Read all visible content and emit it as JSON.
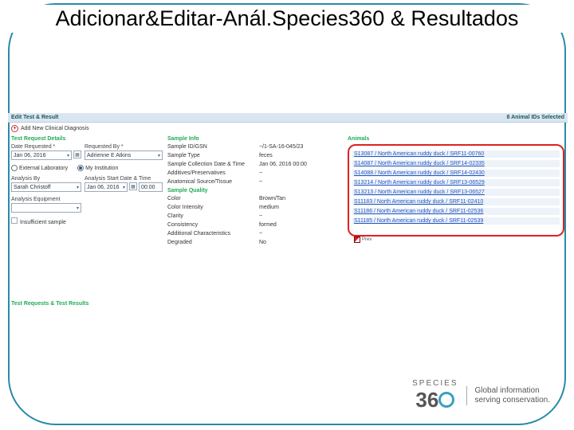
{
  "title": "Adicionar&Editar-Anál.Species360 & Resultados",
  "header": {
    "left": "Edit Test & Result",
    "right": "8 Animal IDs Selected"
  },
  "add_diag": "Add New Clinical Diagnosis",
  "left": {
    "section": "Test Request Details",
    "date_requested_lbl": "Date Requested *",
    "date_requested": "Jan 06, 2016",
    "requested_by_lbl": "Requested By *",
    "requested_by": "Adrienne E Atkins",
    "radio_ext": "External Laboratory",
    "radio_inst": "My Institution",
    "analysis_by_lbl": "Analysis By",
    "analysis_by": "Sarah Christoff",
    "analysis_start_lbl": "Analysis Start Date & Time",
    "analysis_start_date": "Jan 06, 2016",
    "analysis_start_time": "00:00",
    "equip_lbl": "Analysis Equipment",
    "insufficient": "Insufficient sample"
  },
  "mid": {
    "section1": "Sample Info",
    "kv1": [
      {
        "k": "Sample ID/GSN",
        "v": "~/1-SA-16-045/23"
      },
      {
        "k": "Sample Type",
        "v": "feces"
      },
      {
        "k": "Sample Collection Date & Time",
        "v": "Jan 06, 2016 00:00"
      },
      {
        "k": "Additives/Preservatives",
        "v": "~"
      },
      {
        "k": "Anatomical Source/Tissue",
        "v": "~"
      }
    ],
    "section2": "Sample Quality",
    "kv2": [
      {
        "k": "Color",
        "v": "Brown/Tan"
      },
      {
        "k": "Color Intensity",
        "v": "medium"
      },
      {
        "k": "Clarity",
        "v": "~"
      },
      {
        "k": "Consistency",
        "v": "formed"
      },
      {
        "k": "Additional Characteristics",
        "v": "~"
      },
      {
        "k": "Degraded",
        "v": "No"
      }
    ]
  },
  "right": {
    "section": "Animals",
    "items": [
      "S13087 / North American ruddy duck / SRF11-00760",
      "S14087 / North American ruddy duck / SRF14-02335",
      "S14088 / North American ruddy duck / SRF14-02430",
      "S13214 / North American ruddy duck / SRF13-06529",
      "S13213 / North American ruddy duck / SRF13-06527",
      "S11183 / North American ruddy duck / SRF11-02410",
      "S11186 / North American ruddy duck / SRF11-02536",
      "S11185 / North American ruddy duck / SRF11-02539"
    ],
    "prev": "Prev"
  },
  "footer_section": "Test Requests & Test Results",
  "logo": {
    "brand_top": "SPECIES",
    "line1": "Global information",
    "line2": "serving conservation."
  }
}
